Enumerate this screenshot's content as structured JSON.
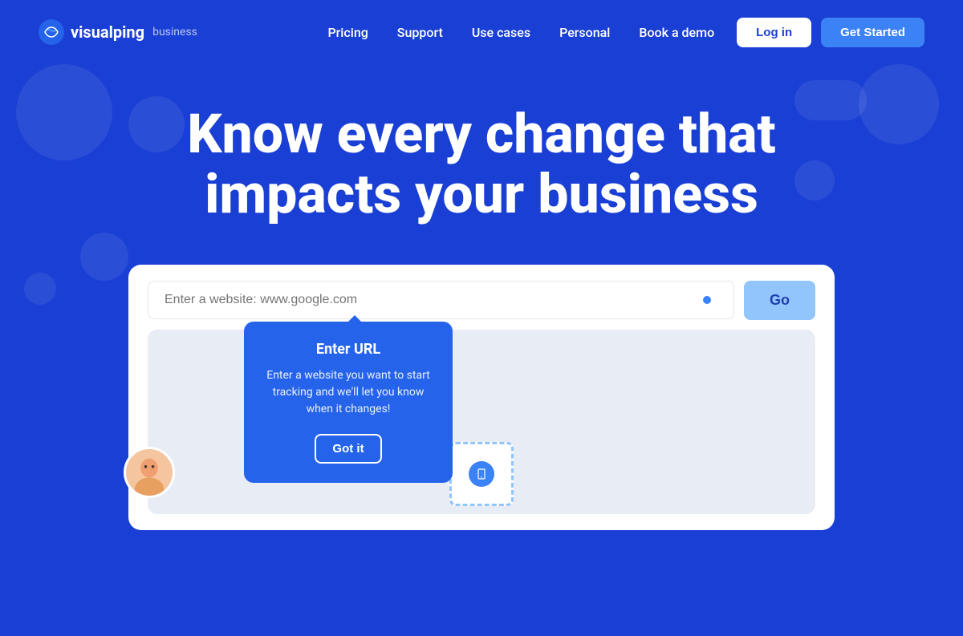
{
  "brand": {
    "logo_text": "visualping",
    "logo_sub": "business"
  },
  "nav": {
    "links": [
      {
        "label": "Pricing",
        "id": "pricing"
      },
      {
        "label": "Support",
        "id": "support"
      },
      {
        "label": "Use cases",
        "id": "use-cases"
      },
      {
        "label": "Personal",
        "id": "personal"
      },
      {
        "label": "Book a demo",
        "id": "book-demo"
      }
    ],
    "login_label": "Log in",
    "started_label": "Get Started"
  },
  "hero": {
    "title_line1": "Know every change that",
    "title_line2": "impacts your business"
  },
  "search": {
    "placeholder": "Enter a website: www.google.com",
    "go_label": "Go"
  },
  "tooltip": {
    "title": "Enter URL",
    "body": "Enter a website you want to start tracking and we'll let you know when it changes!",
    "cta_label": "Got it"
  },
  "colors": {
    "background": "#1a3fd4",
    "accent_blue": "#2563eb",
    "btn_go_bg": "#93c5fd",
    "tooltip_bg": "#2563eb"
  }
}
